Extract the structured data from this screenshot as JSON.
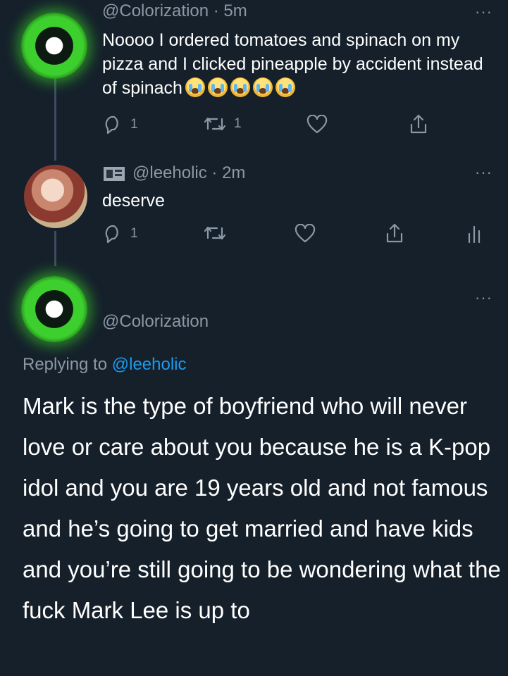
{
  "tweet1": {
    "handle": "@Colorization · 5m",
    "more": "···",
    "text": "Noooo I ordered tomatoes and spinach on my pizza and I clicked pineapple by accident instead of spinach",
    "emoji_count": 5,
    "emoji_name": "loudly-crying-face",
    "reply_count": "1",
    "retweet_count": "1"
  },
  "tweet2": {
    "handle": "@leeholic · 2m",
    "more": "···",
    "text": "deserve",
    "reply_count": "1"
  },
  "tweet3": {
    "more": "···",
    "handle": "@Colorization",
    "replying_prefix": "Replying to",
    "replying_handle": "@leeholic",
    "text": "Mark is the type of boyfriend who will never love or care about you because he is a K-pop idol and you are 19 years old and not famous and he’s going to get married and have kids and you’re still going to be wondering what the fuck Mark Lee is up to"
  },
  "icons": {
    "reply": "reply-icon",
    "retweet": "retweet-icon",
    "like": "heart-icon",
    "share": "share-icon",
    "analytics": "analytics-icon",
    "badge": "badge-icon"
  },
  "colors": {
    "background": "#15202b",
    "secondary_text": "#8b98a5",
    "link": "#1d9bf0",
    "thread_line": "#3d4c5c"
  }
}
